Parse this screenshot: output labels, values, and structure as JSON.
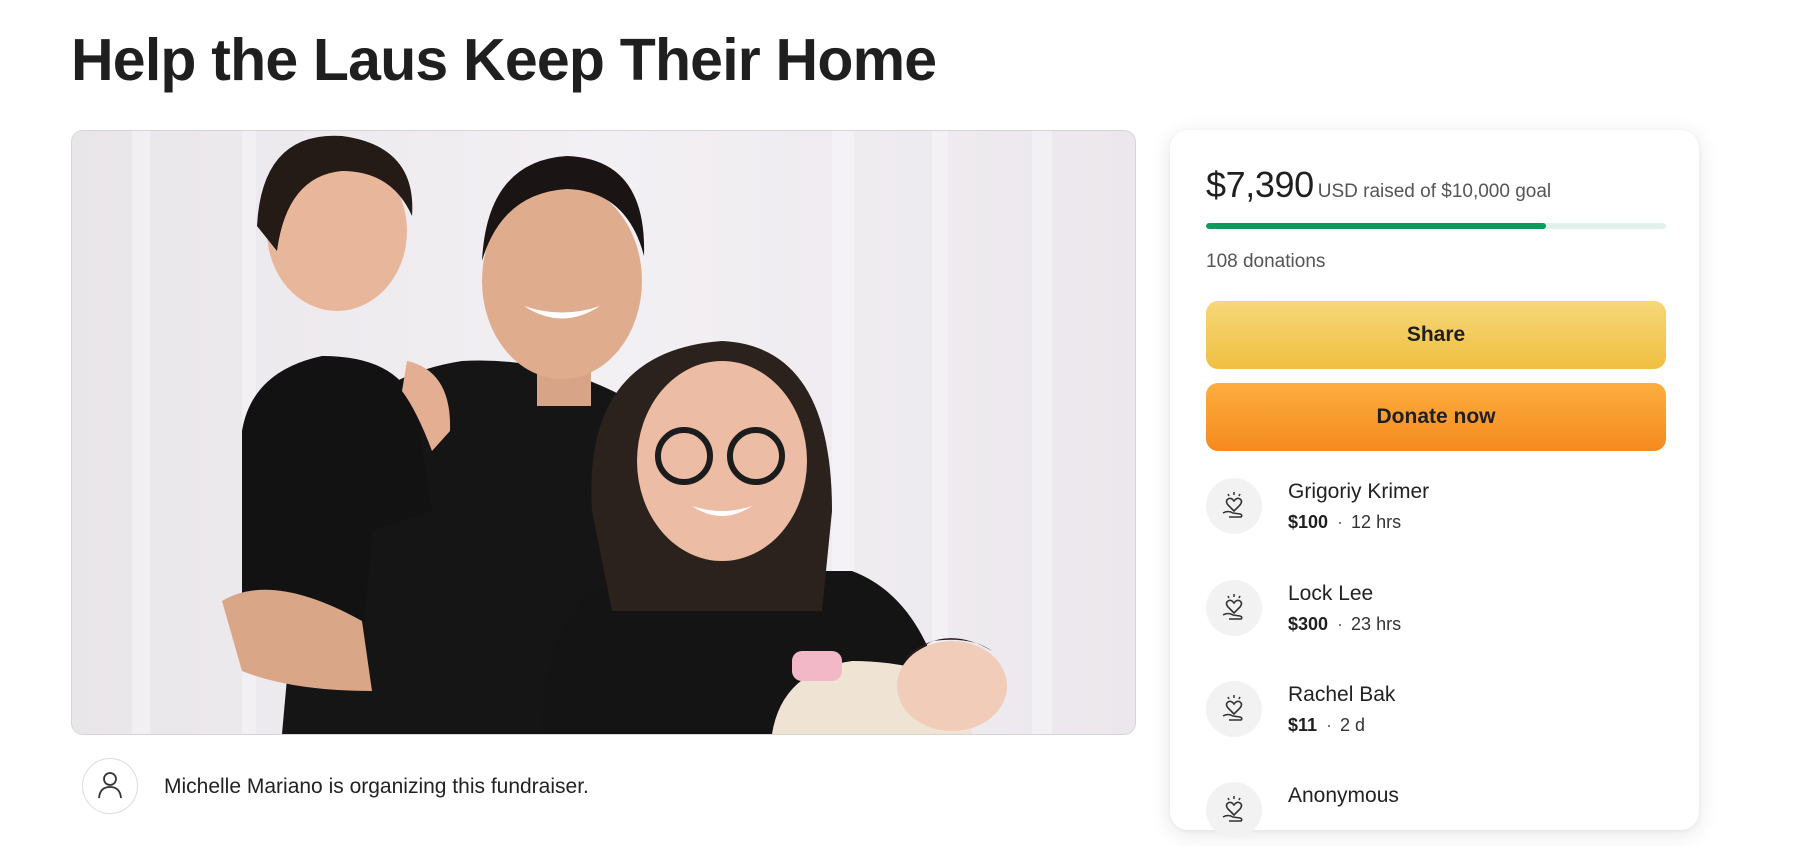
{
  "page": {
    "title": "Help the Laus Keep Their Home"
  },
  "organizer": {
    "text": "Michelle Mariano is organizing this fundraiser.",
    "icon": "person-icon"
  },
  "donation_card": {
    "raised_amount": "$7,390",
    "raised_text": "USD raised of $10,000 goal",
    "progress_fraction": 0.739,
    "donations_count": "108 donations",
    "share_label": "Share",
    "donate_label": "Donate now",
    "donors": [
      {
        "name": "Grigoriy Krimer",
        "amount": "$100",
        "time": "12 hrs",
        "icon": "donation-heart-hand-icon"
      },
      {
        "name": "Lock Lee",
        "amount": "$300",
        "time": "23 hrs",
        "icon": "donation-heart-hand-icon"
      },
      {
        "name": "Rachel Bak",
        "amount": "$11",
        "time": "2 d",
        "icon": "donation-heart-hand-icon"
      },
      {
        "name": "Anonymous",
        "icon": "donation-heart-hand-icon"
      }
    ]
  },
  "colors": {
    "progress_fill": "#0e9a5b",
    "progress_track": "#e3f1ec",
    "share_button": "#f2c654",
    "donate_button": "#f89a2c"
  }
}
